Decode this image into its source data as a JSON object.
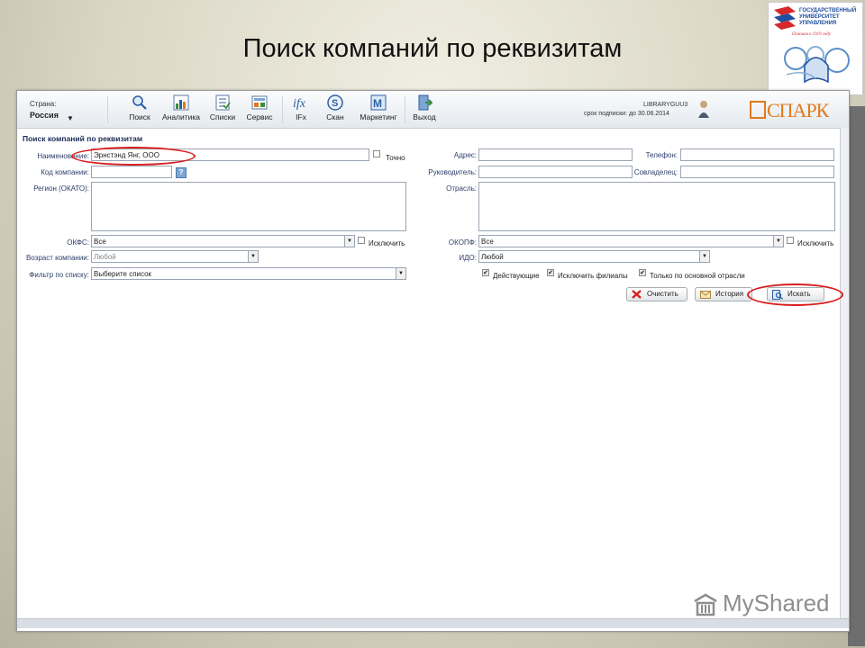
{
  "slide_title": "Поиск компаний по реквизитам",
  "logo": {
    "line1": "ГОСУДАРСТВЕННЫЙ",
    "line2": "УНИВЕРСИТЕТ",
    "line3": "УПРАВЛЕНИЯ",
    "tagline": "Основан в 1919 году",
    "bottom": "БИБЛИОТЕКА УНИВЕРСИТЕТА"
  },
  "toolbar": {
    "country_label": "Страна:",
    "country_value": "Россия",
    "buttons": [
      {
        "label": "Поиск",
        "icon": "magnifier-icon"
      },
      {
        "label": "Аналитика",
        "icon": "analytics-icon"
      },
      {
        "label": "Списки",
        "icon": "lists-icon"
      },
      {
        "label": "Сервис",
        "icon": "service-icon"
      },
      {
        "label": "IFx",
        "icon": "ifx-icon"
      },
      {
        "label": "Скан",
        "icon": "scan-icon"
      },
      {
        "label": "Маркетинг",
        "icon": "marketing-icon"
      },
      {
        "label": "Выход",
        "icon": "exit-icon"
      }
    ],
    "user_name": "LIBRARYGUU3",
    "subscription": "срок подписки: до 30.06.2014",
    "brand": "СПАРК"
  },
  "form": {
    "title": "Поиск компаний по реквизитам",
    "left": {
      "name_label": "Наименование:",
      "name_value": "Эрнстэнд Янг, ООО",
      "exact_label": "Точно",
      "code_label": "Код компании:",
      "code_value": "",
      "help_glyph": "?",
      "region_label": "Регион (ОКАТО):",
      "okfs_label": "ОКФС:",
      "okfs_value": "Все",
      "exclude_label": "Исключить",
      "age_label": "Возраст компании:",
      "age_value": "Любой",
      "filter_label": "Фильтр по списку:",
      "filter_value": "Выберите список"
    },
    "right": {
      "address_label": "Адрес:",
      "phone_label": "Телефон:",
      "head_label": "Руководитель:",
      "owner_label": "Совладелец:",
      "industry_label": "Отрасль:",
      "okopf_label": "ОКОПФ:",
      "okopf_value": "Все",
      "exclude_label": "Исключить",
      "ido_label": "ИДО:",
      "ido_value": "Любой",
      "active_label": "Действующие",
      "exclude_branches_label": "Исключить филиалы",
      "main_industry_label": "Только по основной отрасли"
    },
    "buttons": {
      "clear": "Очистить",
      "history": "История",
      "search": "Искать"
    }
  },
  "watermark": "MyShared",
  "colors": {
    "annotation_red": "#d81e1e",
    "brand_orange": "#e07a1c",
    "label_blue": "#2d3d6b"
  }
}
